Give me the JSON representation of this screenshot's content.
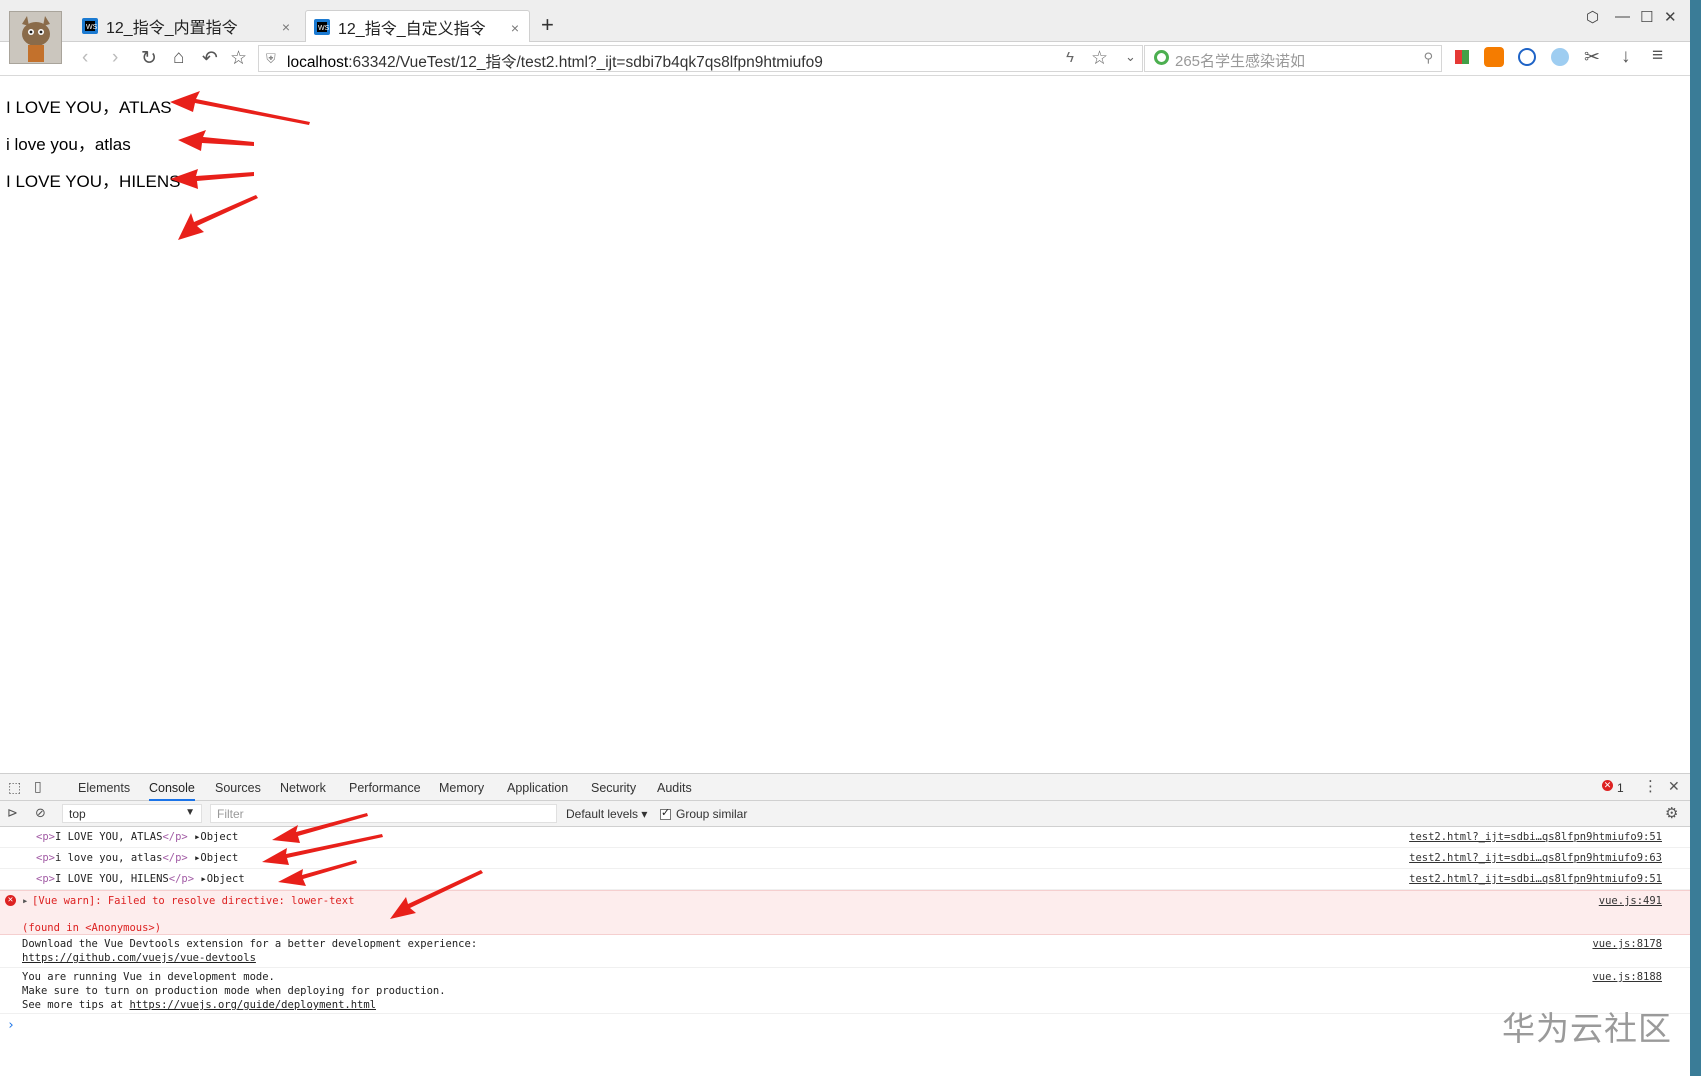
{
  "browser": {
    "tabs": [
      {
        "title": "12_指令_内置指令",
        "close": "×"
      },
      {
        "title": "12_指令_自定义指令",
        "close": "×"
      }
    ],
    "new_tab": "+",
    "url_host": "localhost",
    "url_rest": ":63342/VueTest/12_指令/test2.html?_ijt=sdbi7b4qk7qs8lfpn9htmiufo9",
    "search_placeholder": "265名学生感染诺如"
  },
  "page": {
    "lines": [
      "I LOVE YOU，ATLAS",
      "i love you，atlas",
      "I LOVE YOU，HILENS"
    ]
  },
  "devtools": {
    "tabs": [
      "Elements",
      "Console",
      "Sources",
      "Network",
      "Performance",
      "Memory",
      "Application",
      "Security",
      "Audits"
    ],
    "error_count": "1",
    "context": "top",
    "filter_placeholder": "Filter",
    "levels": "Default levels ▾",
    "group_similar": "Group similar",
    "rows": [
      {
        "open": "<p>",
        "text": "I LOVE YOU, ATLAS",
        "close": "</p>",
        "obj": "Object",
        "src": "test2.html?_ijt=sdbi…qs8lfpn9htmiufo9:51"
      },
      {
        "open": "<p>",
        "text": "i love you, atlas",
        "close": "</p>",
        "obj": "Object",
        "src": "test2.html?_ijt=sdbi…qs8lfpn9htmiufo9:63"
      },
      {
        "open": "<p>",
        "text": "I LOVE YOU, HILENS",
        "close": "</p>",
        "obj": "Object",
        "src": "test2.html?_ijt=sdbi…qs8lfpn9htmiufo9:51"
      }
    ],
    "warn": {
      "line1": "[Vue warn]: Failed to resolve directive: lower-text",
      "line2": "(found in <Anonymous>)",
      "src": "vue.js:491"
    },
    "devtools_msg": {
      "line1": "Download the Vue Devtools extension for a better development experience:",
      "link": "https://github.com/vuejs/vue-devtools",
      "src": "vue.js:8178"
    },
    "devmode_msg": {
      "line1": "You are running Vue in development mode.",
      "line2": "Make sure to turn on production mode when deploying for production.",
      "line3_prefix": "See more tips at ",
      "link": "https://vuejs.org/guide/deployment.html",
      "src": "vue.js:8188"
    },
    "prompt": "›"
  },
  "watermark": "华为云社区",
  "colors": {
    "accent": "#1a73e8",
    "annotation": "#e8201a",
    "error": "#d22222"
  }
}
